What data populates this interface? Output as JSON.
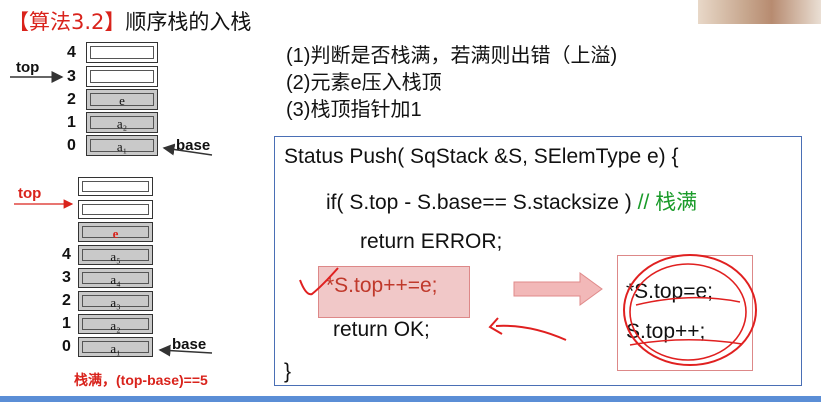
{
  "title": {
    "bracket_open": "【",
    "algorithm": "算法3.2",
    "bracket_close": "】",
    "name": "顺序栈的入栈"
  },
  "stack1": {
    "indices": [
      "4",
      "3",
      "2",
      "1",
      "0"
    ],
    "cells": [
      "",
      "",
      "e",
      "a₂",
      "a₁"
    ],
    "top_label": "top",
    "base_label": "base"
  },
  "stack2": {
    "indices": [
      "4",
      "3",
      "2",
      "1",
      "0"
    ],
    "cells": [
      "",
      "",
      "e",
      "a₅",
      "a₄",
      "a₃",
      "a₂",
      "a₁"
    ],
    "top_label": "top",
    "base_label": "base",
    "full_note": "栈满，(top-base)==5"
  },
  "steps": [
    "(1)判断是否栈满，若满则出错（上溢)",
    "(2)元素e压入栈顶",
    "(3)栈顶指针加1"
  ],
  "code": {
    "line1": "Status Push( SqStack &S, SElemType e) {",
    "line2": "if( S.top - S.base== S.stacksize )",
    "line2_comment": "// 栈满",
    "line3": "return ERROR;",
    "line4": "*S.top++=e;",
    "line5": "return OK;",
    "line6": "}"
  },
  "expansion": {
    "line1": "*S.top=e;",
    "line2": "S.top++;"
  },
  "colors": {
    "accent_red": "#d9231c",
    "comment_green": "#1a9b2a",
    "code_border": "#4a6fb5",
    "highlight": "#f1c8c8"
  }
}
